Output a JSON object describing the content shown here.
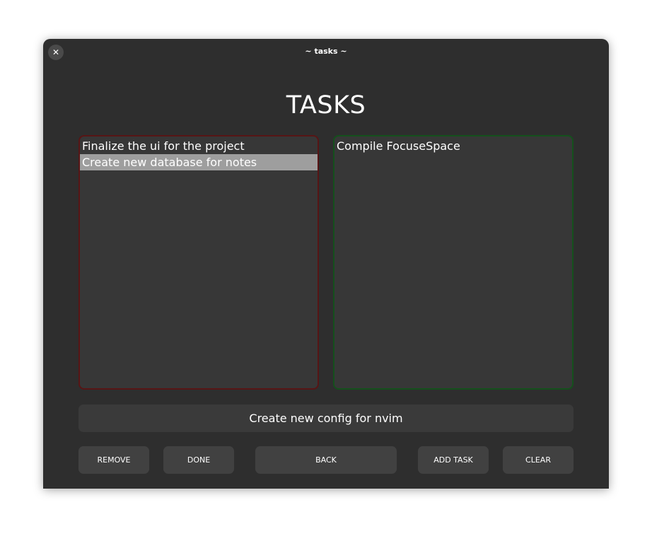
{
  "window": {
    "title": "~ tasks ~",
    "close_glyph": "✕"
  },
  "page": {
    "heading": "TASKS"
  },
  "pending_list": {
    "border_color": "#571515",
    "items": [
      {
        "label": "Finalize the ui for the project",
        "selected": false
      },
      {
        "label": "Create new database for notes",
        "selected": true
      }
    ]
  },
  "done_list": {
    "border_color": "#14501c",
    "items": [
      {
        "label": "Compile FocuseSpace",
        "selected": false
      }
    ]
  },
  "task_entry": {
    "value": "Create new config for nvim"
  },
  "buttons": {
    "remove": "REMOVE",
    "done": "DONE",
    "back": "BACK",
    "add_task": "ADD TASK",
    "clear": "CLEAR"
  },
  "colors": {
    "window_bg": "#2e2e2e",
    "list_bg": "#373737",
    "selection": "#9e9e9e",
    "button_bg": "#414141"
  }
}
